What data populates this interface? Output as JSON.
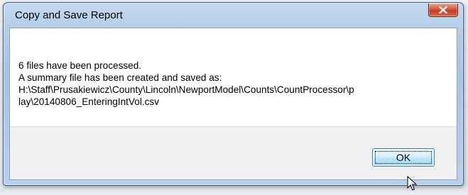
{
  "window": {
    "title": "Copy and Save Report",
    "close_icon": "close-icon"
  },
  "message": {
    "lines": [
      "6 files have been processed.",
      "A summary file has been created and saved as:",
      "H:\\Staff\\Prusakiewicz\\County\\Lincoln\\NewportModel\\Counts\\CountProcessor\\p",
      "lay\\20140806_EnteringIntVol.csv"
    ]
  },
  "buttons": {
    "ok_label": "OK"
  },
  "colors": {
    "close_button": "#c23a22",
    "frame": "#a9c4e2",
    "footer": "#f0f0f0"
  }
}
